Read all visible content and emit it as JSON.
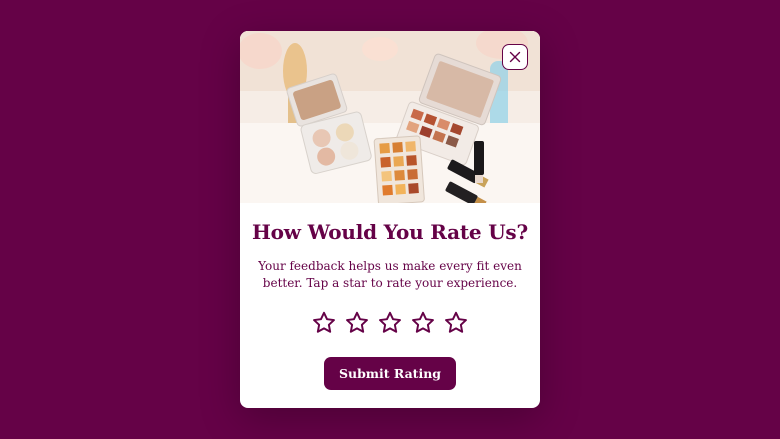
{
  "colors": {
    "brand": "#650247",
    "background": "#650247",
    "card": "#ffffff"
  },
  "modal": {
    "image_alt": "makeup-palettes-photo",
    "close_icon": "close-icon",
    "title": "How Would You Rate Us?",
    "description": "Your feedback helps us make every fit even better. Tap a star to rate your experience.",
    "rating": {
      "max": 5,
      "selected": 0
    },
    "submit_label": "Submit Rating"
  }
}
